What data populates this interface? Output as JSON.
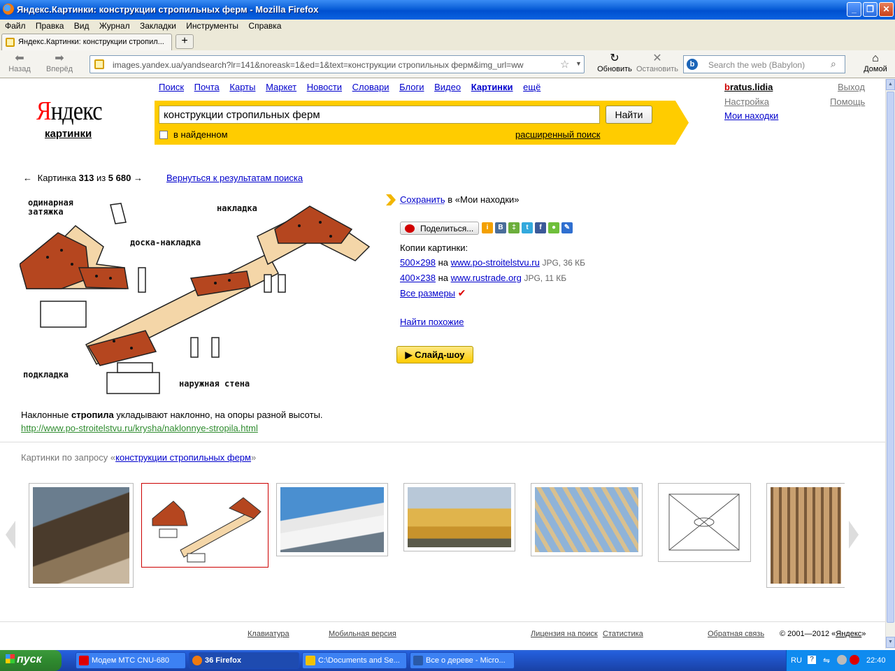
{
  "window": {
    "title": "Яндекс.Картинки: конструкции стропильных ферм - Mozilla Firefox",
    "min": "_",
    "max": "❐",
    "close": "✕"
  },
  "menu": [
    "Файл",
    "Правка",
    "Вид",
    "Журнал",
    "Закладки",
    "Инструменты",
    "Справка"
  ],
  "tab": {
    "label": "Яндекс.Картинки: конструкции стропил...",
    "new_tab": "+"
  },
  "nav": {
    "back": "Назад",
    "forward": "Вперёд",
    "reload": "Обновить",
    "stop": "Остановить",
    "home": "Домой",
    "url": "images.yandex.ua/yandsearch?lr=141&noreask=1&ed=1&text=конструкции стропильных ферм&img_url=ww",
    "search_placeholder": "Search the web (Babylon)"
  },
  "yandex": {
    "logo_first": "Я",
    "logo_rest": "ндекс",
    "logo_sub": "картинки",
    "services": [
      "Поиск",
      "Почта",
      "Карты",
      "Маркет",
      "Новости",
      "Словари",
      "Блоги",
      "Видео",
      "Картинки",
      "ещё"
    ],
    "active_service": "Картинки",
    "query": "конструкции стропильных ферм",
    "search_button": "Найти",
    "in_found": "в найденном",
    "advanced": "расширенный поиск",
    "user_first": "b",
    "user_rest": "ratus.lidia",
    "exit": "Выход",
    "settings": "Настройка",
    "help": "Помощь",
    "my_finds": "Мои находки"
  },
  "pager": {
    "prefix": "Картинка",
    "current": "313",
    "of": "из",
    "total": "5 680",
    "prev": "←",
    "next": "→",
    "back_to_results": "Вернуться к результатам поиска"
  },
  "diagram_labels": {
    "a": "одинарная",
    "b": "затяжка",
    "c": "накладка",
    "d": "доска-накладка",
    "e": "подкладка",
    "f": "наружная стена"
  },
  "caption": {
    "before": "Наклонные ",
    "bold": "стропила",
    "after": " укладывают наклонно, на опоры разной высоты."
  },
  "source_url": "http://www.po-stroitelstvu.ru/krysha/naklonnye-stropila.html",
  "sidebar": {
    "save": "Сохранить",
    "save_suffix": " в «Мои находки»",
    "share": "Поделиться...",
    "copies_title": "Копии картинки:",
    "copies": [
      {
        "size": "500×298",
        "on": "на",
        "site": "www.po-stroitelstvu.ru",
        "meta": "JPG, 36 КБ"
      },
      {
        "size": "400×238",
        "on": "на",
        "site": "www.rustrade.org",
        "meta": "JPG, 11 КБ"
      }
    ],
    "all_sizes": "Все размеры",
    "check": "✔",
    "similar": "Найти похожие",
    "slideshow": "▶ Слайд-шоу"
  },
  "related": {
    "prefix": "Картинки по запросу «",
    "query": "конструкции стропильных ферм",
    "suffix": "»"
  },
  "footer": {
    "keyboard": "Клавиатура",
    "mobile": "Мобильная версия",
    "license": "Лицензия на поиск",
    "stats": "Статистика",
    "feedback": "Обратная связь",
    "copyright_prefix": "© 2001—2012 «",
    "copyright_link": "Яндекс",
    "copyright_suffix": "»"
  },
  "taskbar": {
    "start": "пуск",
    "tasks": [
      {
        "label": "Модем МТС CNU-680",
        "color": "#d00"
      },
      {
        "label": "36 Firefox",
        "color": "#f07a10"
      },
      {
        "label": "C:\\Documents and Se...",
        "color": "#f2c200"
      },
      {
        "label": "Все о дереве - Micro...",
        "color": "#2a5aa8"
      }
    ],
    "lang": "RU",
    "clock": "22:40"
  }
}
